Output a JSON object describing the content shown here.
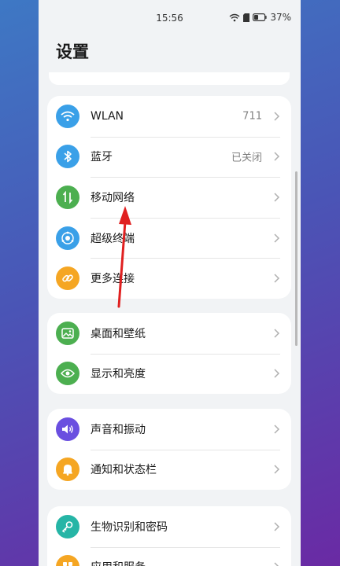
{
  "status_bar": {
    "time": "15:56",
    "battery": "37%",
    "icons": [
      "wifi-icon",
      "battery-icon"
    ]
  },
  "header": {
    "title": "设置"
  },
  "groups": [
    {
      "items": [
        {
          "label": "WLAN",
          "value": "711",
          "icon": "wifi-icon",
          "color": "#3aa0e8"
        },
        {
          "label": "蓝牙",
          "value": "已关闭",
          "icon": "bluetooth-icon",
          "color": "#3aa0e8"
        },
        {
          "label": "移动网络",
          "value": "",
          "icon": "mobile-data-icon",
          "color": "#4caf50"
        },
        {
          "label": "超级终端",
          "value": "",
          "icon": "super-device-icon",
          "color": "#3aa0e8"
        },
        {
          "label": "更多连接",
          "value": "",
          "icon": "link-icon",
          "color": "#f5a623"
        }
      ]
    },
    {
      "items": [
        {
          "label": "桌面和壁纸",
          "value": "",
          "icon": "wallpaper-icon",
          "color": "#4caf50"
        },
        {
          "label": "显示和亮度",
          "value": "",
          "icon": "eye-icon",
          "color": "#4caf50"
        }
      ]
    },
    {
      "items": [
        {
          "label": "声音和振动",
          "value": "",
          "icon": "speaker-icon",
          "color": "#6a4fe0"
        },
        {
          "label": "通知和状态栏",
          "value": "",
          "icon": "bell-icon",
          "color": "#f5a623"
        }
      ]
    },
    {
      "items": [
        {
          "label": "生物识别和密码",
          "value": "",
          "icon": "key-icon",
          "color": "#26b5a6"
        },
        {
          "label": "应用和服务",
          "value": "",
          "icon": "apps-icon",
          "color": "#f5a623"
        }
      ]
    }
  ]
}
